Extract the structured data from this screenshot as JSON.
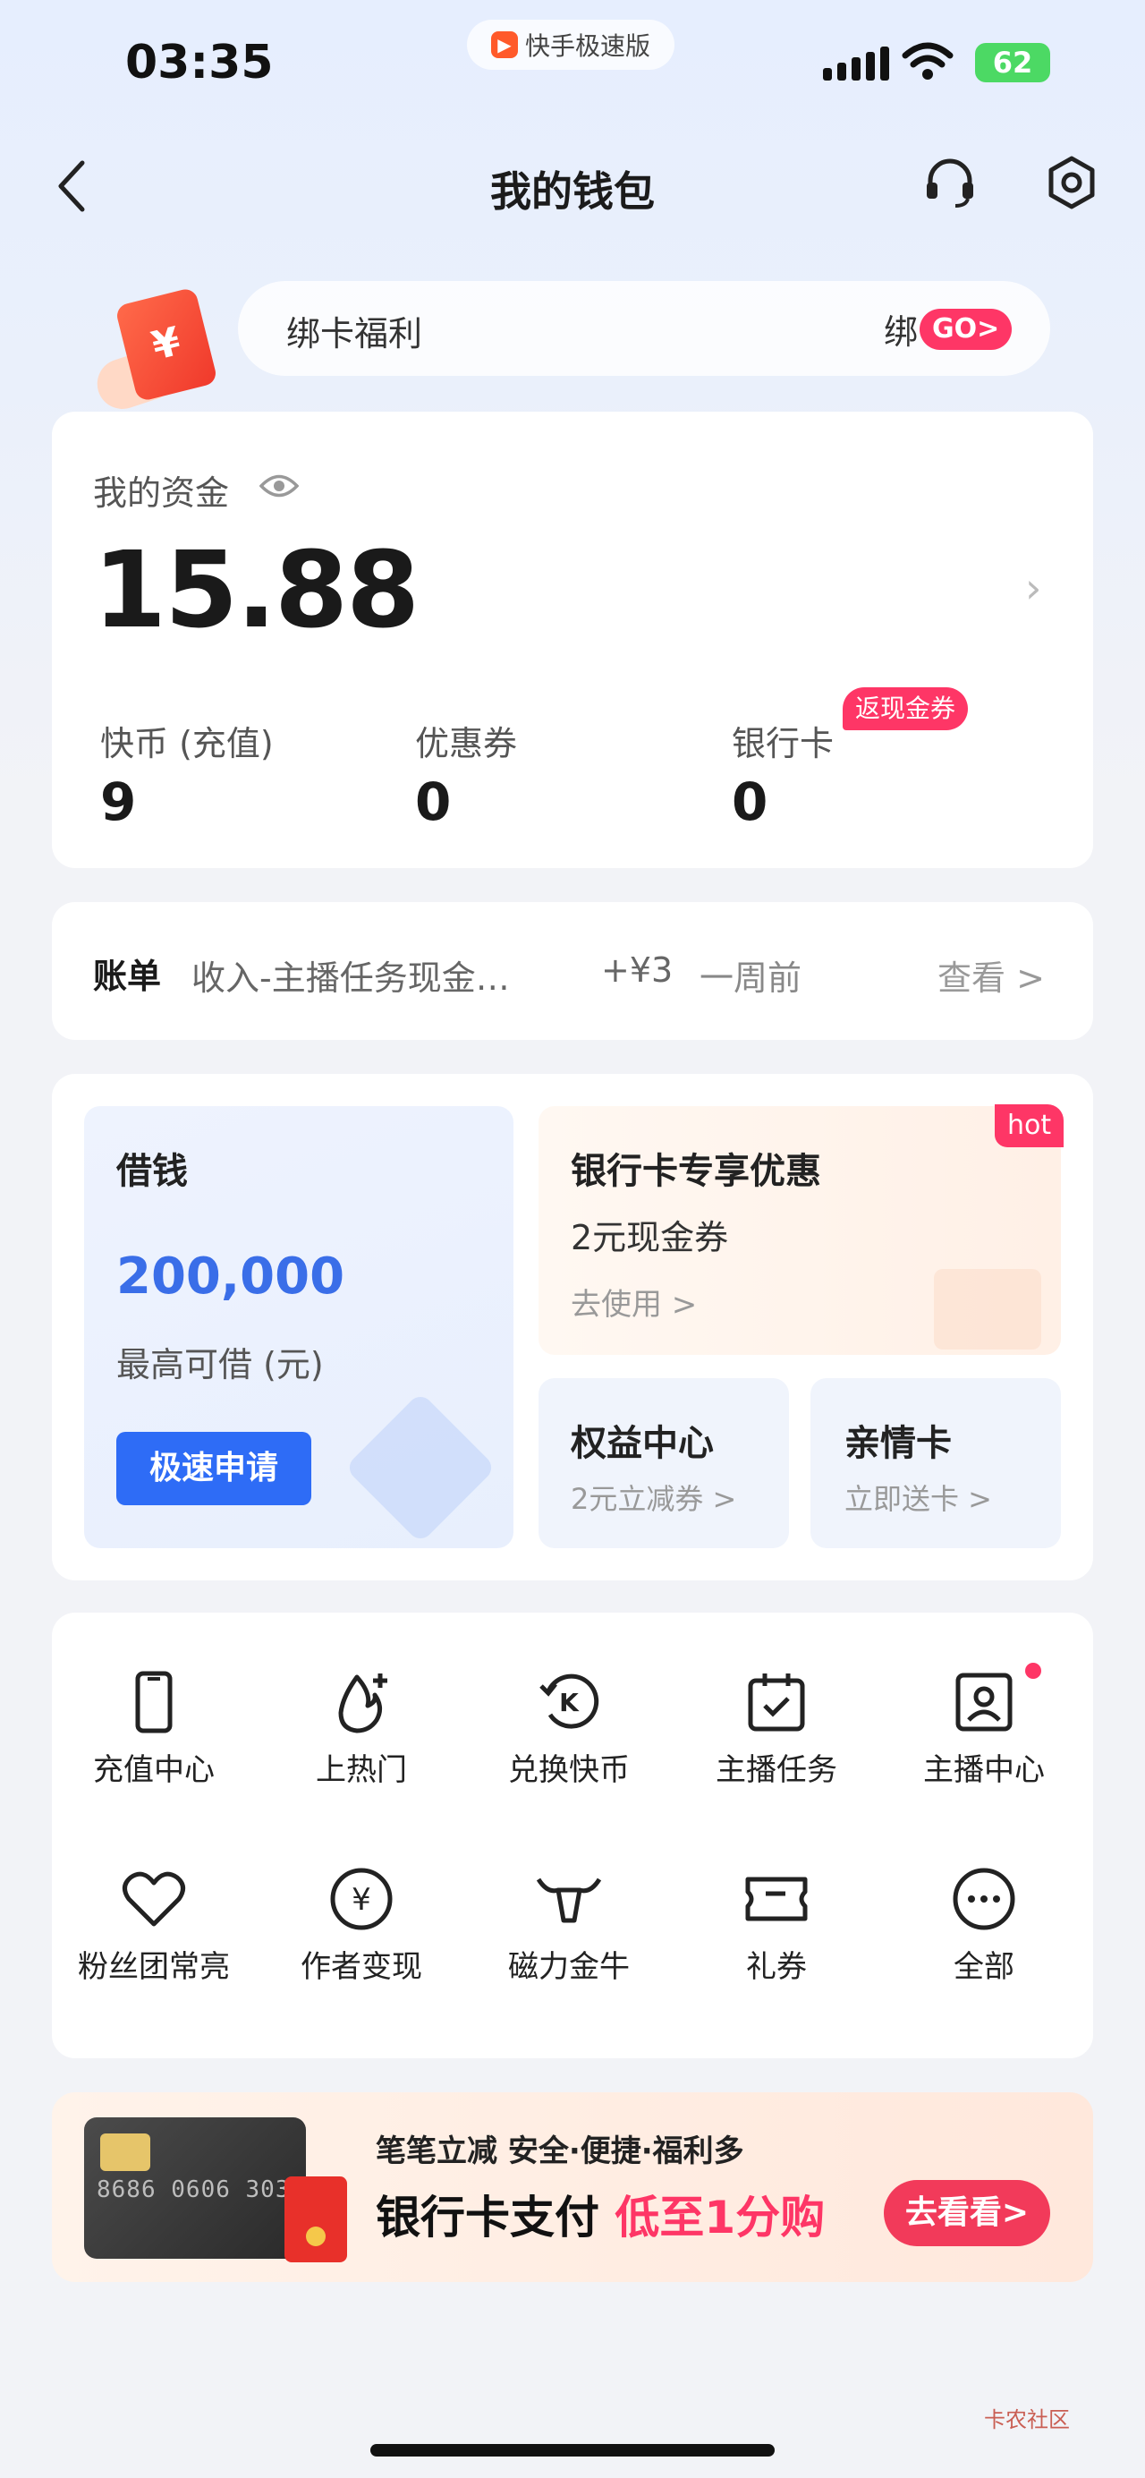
{
  "status_bar": {
    "time": "03:35",
    "app_name": "快手极速版",
    "battery": "62"
  },
  "header": {
    "title": "我的钱包"
  },
  "bind_banner": {
    "text": "绑卡福利",
    "action_prefix": "绑",
    "go_label": "GO>"
  },
  "funds": {
    "label": "我的资金",
    "amount": "15.88",
    "stats": [
      {
        "label": "快币 (充值)",
        "value": "9"
      },
      {
        "label": "优惠券",
        "value": "0"
      },
      {
        "label": "银行卡",
        "value": "0"
      }
    ],
    "cashback_badge": "返现金券"
  },
  "bill": {
    "title": "账单",
    "desc": "收入-主播任务现金…",
    "amount": "+¥3",
    "time": "一周前",
    "view": "查看 >"
  },
  "loan": {
    "title": "借钱",
    "amount": "200,000",
    "sub": "最高可借 (元)",
    "button": "极速申请"
  },
  "promo": {
    "badge": "hot",
    "title": "银行卡专享优惠",
    "sub": "2元现金券",
    "action": "去使用 >"
  },
  "small_cards": [
    {
      "title": "权益中心",
      "sub": "2元立减券 >"
    },
    {
      "title": "亲情卡",
      "sub": "立即送卡 >"
    }
  ],
  "grid": [
    {
      "label": "充值中心",
      "icon": "phone-icon"
    },
    {
      "label": "上热门",
      "icon": "fire-plus-icon"
    },
    {
      "label": "兑换快币",
      "icon": "coin-exchange-icon"
    },
    {
      "label": "主播任务",
      "icon": "calendar-check-icon"
    },
    {
      "label": "主播中心",
      "icon": "profile-card-icon"
    },
    {
      "label": "粉丝团常亮",
      "icon": "heart-icon"
    },
    {
      "label": "作者变现",
      "icon": "yuan-icon"
    },
    {
      "label": "磁力金牛",
      "icon": "bull-icon"
    },
    {
      "label": "礼券",
      "icon": "ticket-icon"
    },
    {
      "label": "全部",
      "icon": "more-icon"
    }
  ],
  "bank_banner": {
    "line1": "笔笔立减 安全·便捷·福利多",
    "line2_prefix": "银行卡支付 ",
    "line2_highlight": "低至1分购",
    "card_number": "8686 0606 303",
    "button": "去看看>"
  },
  "watermark": "卡农社区"
}
